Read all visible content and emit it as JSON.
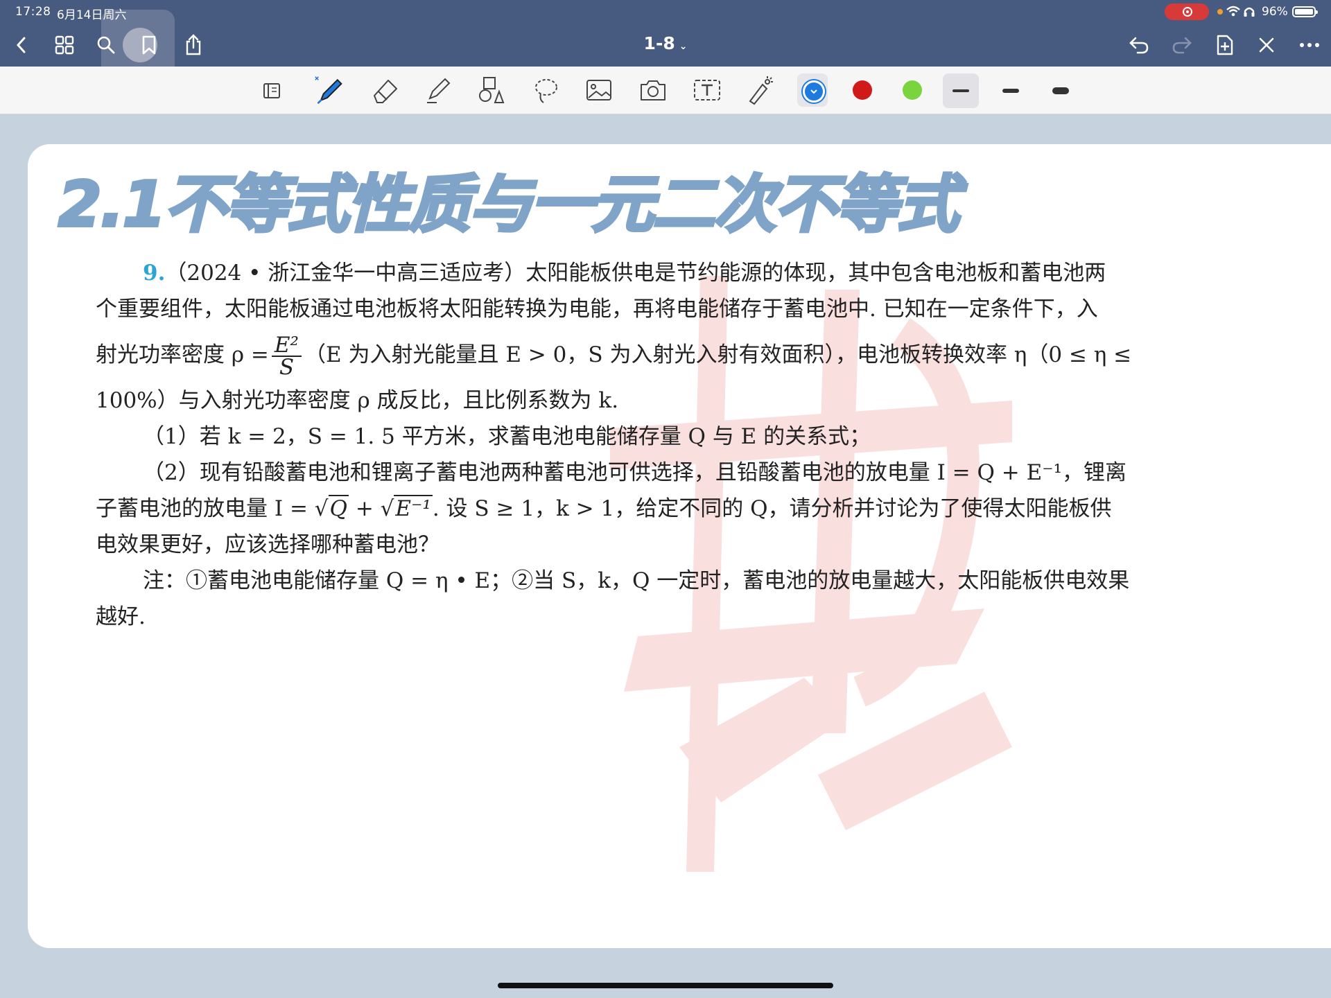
{
  "status": {
    "time": "17:28",
    "date": "6月14日周六",
    "battery": "96%"
  },
  "nav": {
    "title": "1-8",
    "chevron": "⌄"
  },
  "toolbar": {
    "colors": {
      "blue": "#1f7ae0",
      "red": "#d01919",
      "green": "#7ad43f"
    }
  },
  "page": {
    "heading": "2.1不等式性质与一元二次不等式",
    "problem": {
      "number": "9.",
      "l1": "（2024 • 浙江金华一中高三适应考）太阳能板供电是节约能源的体现，其中包含电池板和蓄电池两",
      "l2": "个重要组件，太阳能板通过电池板将太阳能转换为电能，再将电能储存于蓄电池中. 已知在一定条件下，入",
      "l3a": "射光功率密度 ρ =",
      "frac_num": "E²",
      "frac_den": "S",
      "l3b": "（E 为入射光能量且 E > 0，S 为入射光入射有效面积），电池板转换效率 η（0 ≤ η ≤",
      "l4": "100%）与入射光功率密度 ρ 成反比，且比例系数为 k.",
      "p1": "（1）若 k = 2，S = 1. 5 平方米，求蓄电池电能储存量 Q 与 E 的关系式；",
      "p2a": "（2）现有铅酸蓄电池和锂离子蓄电池两种蓄电池可供选择，且铅酸蓄电池的放电量 I = Q + E⁻¹，锂离",
      "p2b_1": "子蓄电池的放电量 I =",
      "sqrt1": "Q",
      "p2b_2": "+",
      "sqrt2": "E⁻¹",
      "p2b_3": ". 设 S ≥ 1，k > 1，给定不同的 Q，请分析并讨论为了使得太阳能板供",
      "p2c": "电效果更好，应该选择哪种蓄电池？",
      "note1": "注：①蓄电池电能储存量 Q = η • E；②当 S，k，Q 一定时，蓄电池的放电量越大，太阳能板供电效果",
      "note2": "越好."
    }
  }
}
